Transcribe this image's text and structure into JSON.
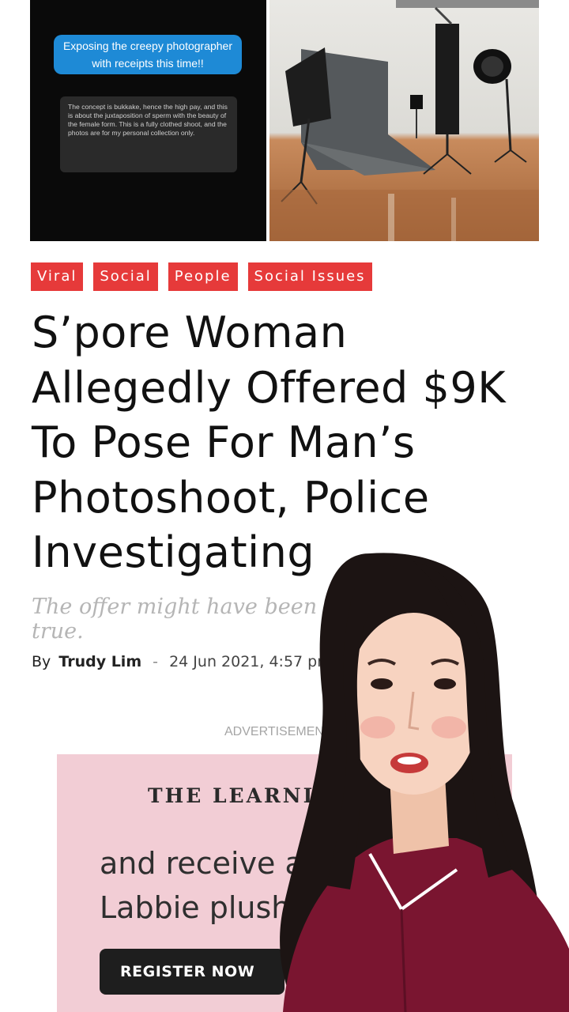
{
  "top_images": {
    "left_caption": "Exposing the creepy photographer with receipts this time!!",
    "left_quote": "The concept is bukkake, hence the high pay, and this is about the juxtaposition of sperm with the beauty of the female form. This is a fully clothed shoot, and the photos are for my personal collection only."
  },
  "tags": [
    "Viral",
    "Social",
    "People",
    "Social Issues"
  ],
  "article": {
    "headline": "S’pore Woman Allegedly Offered $9K To Pose For Man’s Photoshoot, Police Investigating",
    "subtitle": "The offer might have been too good to be true.",
    "by_label": "By",
    "author": "Trudy Lim",
    "separator": "-",
    "date": "24 Jun 2021, 4:57 pm"
  },
  "ad": {
    "label": "ADVERTISEMENT",
    "brand": "THE LEARNING LAB",
    "body_line1": "and receive a free",
    "body_line2": "Labbie plushie",
    "button": "REGISTER NOW"
  },
  "colors": {
    "tag_red": "#e63a3a",
    "caption_blue": "#1e8ad6",
    "ad_pink": "#f2cdd5",
    "shirt_maroon": "#7a1530"
  }
}
